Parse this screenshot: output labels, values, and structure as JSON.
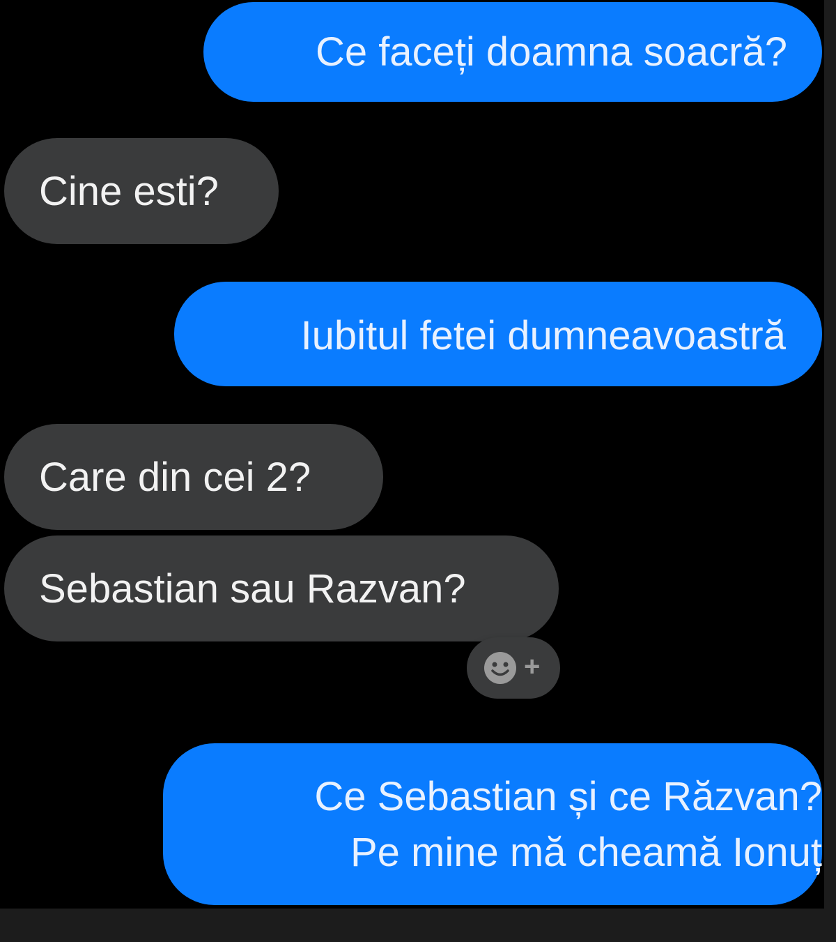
{
  "conversation": {
    "messages": [
      {
        "direction": "outgoing",
        "text": "Ce faceți doamna soacră?"
      },
      {
        "direction": "incoming",
        "text": "Cine esti?"
      },
      {
        "direction": "outgoing",
        "text": "Iubitul fetei dumneavoastră"
      },
      {
        "direction": "incoming",
        "text": "Care din cei 2?"
      },
      {
        "direction": "incoming",
        "text": "Sebastian sau Razvan?"
      },
      {
        "direction": "outgoing",
        "lines": [
          "Ce Sebastian și ce Răzvan?",
          "Pe mine mă cheamă Ionuț"
        ]
      }
    ],
    "reaction_button": {
      "icon": "smiley-icon",
      "plus": "+"
    }
  },
  "colors": {
    "background": "#000000",
    "outgoing_bubble": "#0a7cff",
    "incoming_bubble": "#3a3b3c",
    "text": "#ffffff"
  }
}
